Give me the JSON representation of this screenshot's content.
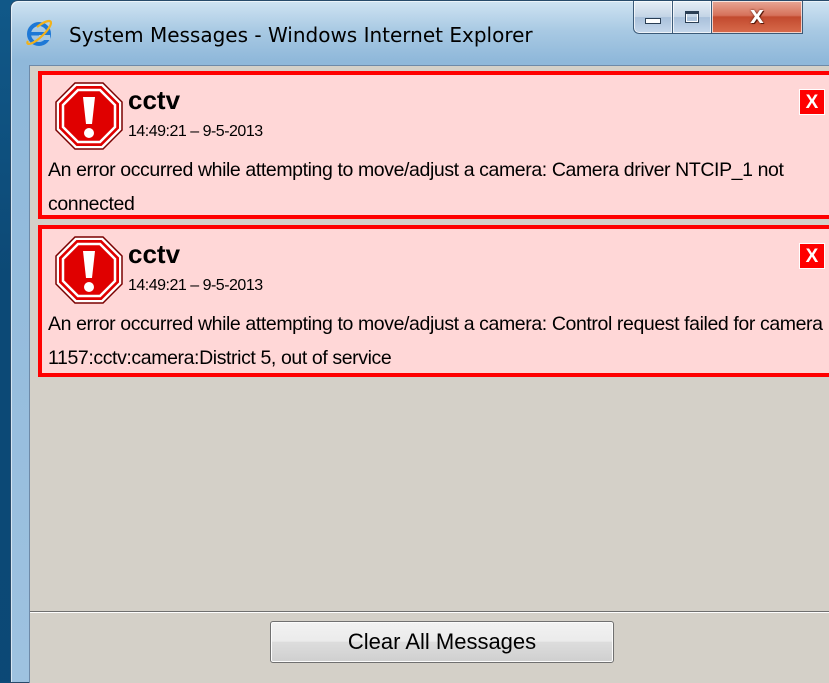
{
  "window": {
    "title": "System Messages - Windows Internet Explorer",
    "close_glyph": "X"
  },
  "messages": [
    {
      "source": "cctv",
      "timestamp": "14:49:21 – 9-5-2013",
      "body": "An error occurred while attempting to move/adjust a camera: Camera driver NTCIP_1 not connected",
      "close_label": "X",
      "icon": "error-stop-icon"
    },
    {
      "source": "cctv",
      "timestamp": "14:49:21 – 9-5-2013",
      "body": "An error occurred while attempting to move/adjust a camera: Control request failed for camera 1157:cctv:camera:District 5, out of service",
      "close_label": "X",
      "icon": "error-stop-icon"
    }
  ],
  "footer": {
    "clear_all_label": "Clear All Messages"
  },
  "colors": {
    "message_border": "#ff0000",
    "message_background": "#ffd7d7",
    "client_background": "#d4d0c8"
  }
}
